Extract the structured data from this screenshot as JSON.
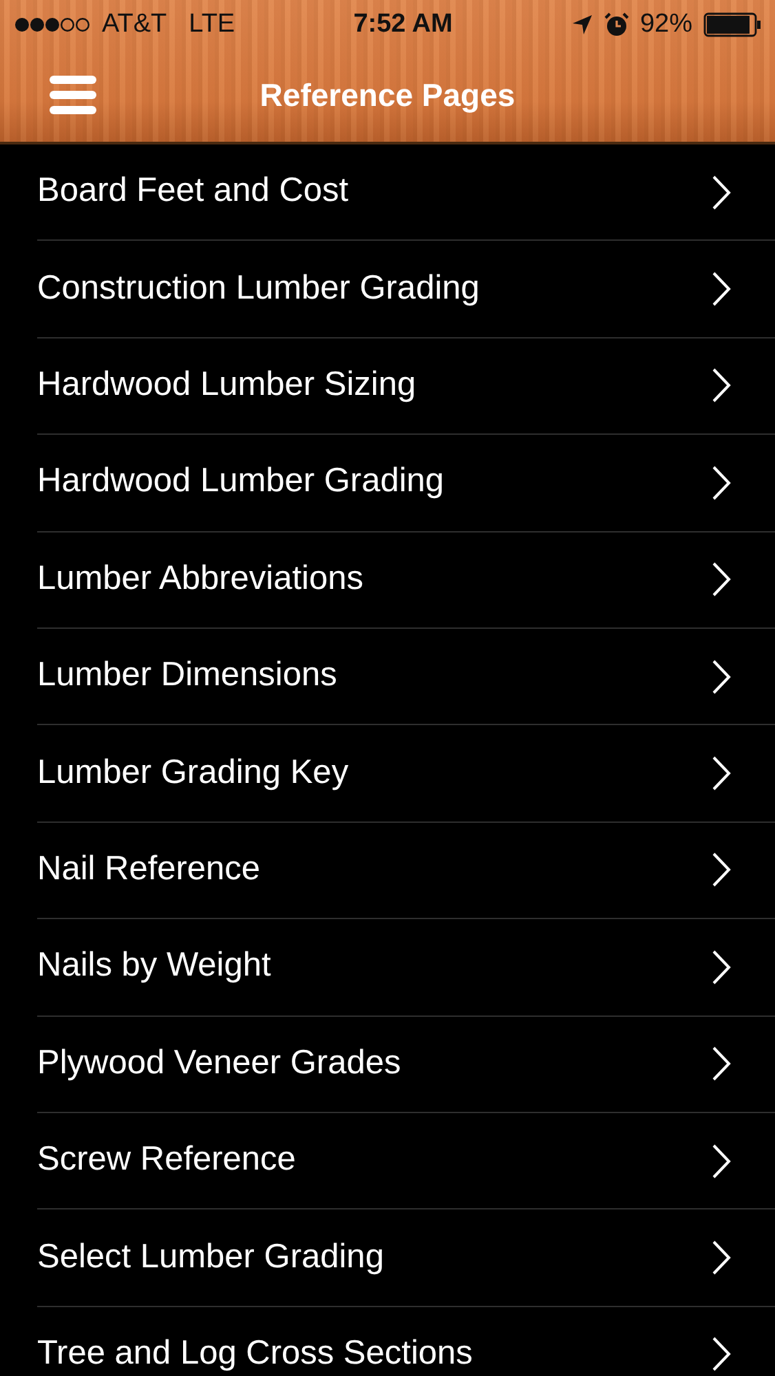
{
  "status_bar": {
    "carrier": "AT&T",
    "network": "LTE",
    "time": "7:52 AM",
    "battery": "92%"
  },
  "nav_bar": {
    "title": "Reference Pages"
  },
  "items": [
    {
      "label": "Board Feet and Cost"
    },
    {
      "label": "Construction Lumber Grading"
    },
    {
      "label": "Hardwood Lumber Sizing"
    },
    {
      "label": "Hardwood Lumber Grading"
    },
    {
      "label": "Lumber Abbreviations"
    },
    {
      "label": "Lumber Dimensions"
    },
    {
      "label": "Lumber Grading Key"
    },
    {
      "label": "Nail Reference"
    },
    {
      "label": "Nails by Weight"
    },
    {
      "label": "Plywood Veneer Grades"
    },
    {
      "label": "Screw Reference"
    },
    {
      "label": "Select Lumber Grading"
    },
    {
      "label": "Tree and Log Cross Sections"
    }
  ]
}
